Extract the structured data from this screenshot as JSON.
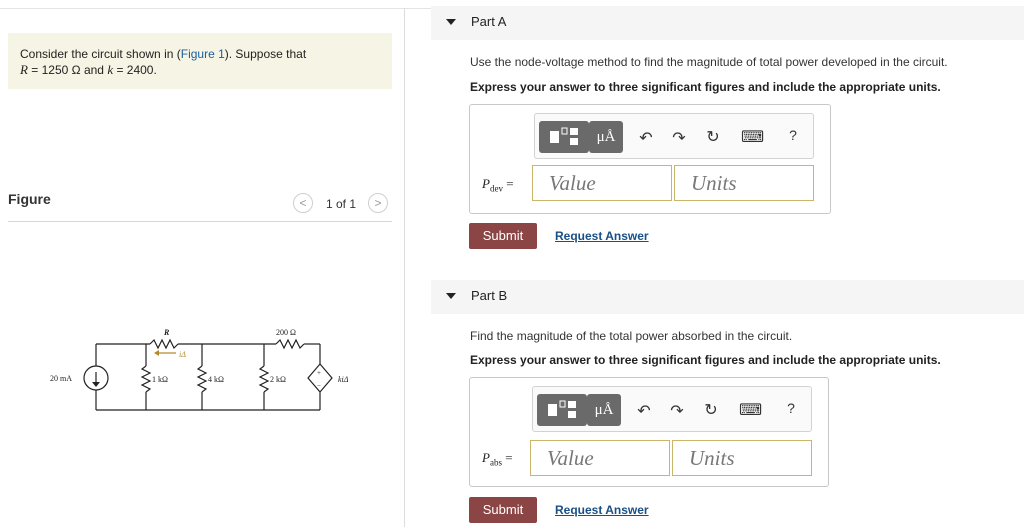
{
  "problem": {
    "prefix": "Consider the circuit shown in (",
    "figure_link": "Figure 1",
    "suffix": "). Suppose that",
    "line2_R": "R",
    "line2_rest": " = 1250  Ω and ",
    "line2_k": "k",
    "line2_end": " = 2400."
  },
  "figure": {
    "title": "Figure",
    "pager": "1 of 1",
    "prev_glyph": "<",
    "next_glyph": ">",
    "labels": {
      "R": "R",
      "ia": "iΔ",
      "r200": "200 Ω",
      "src": "20 mA",
      "r1k": "1 kΩ",
      "r4k": "4 kΩ",
      "r2k": "2 kΩ",
      "dep": "kiΔ",
      "plus": "+",
      "minus": "−"
    }
  },
  "partA": {
    "label": "Part A",
    "question": "Use the node-voltage method to find the magnitude of total power developed in the circuit.",
    "instruction": "Express your answer to three significant figures and include the appropriate units.",
    "var": "P",
    "var_sub": "dev",
    "eq": " =",
    "value_placeholder": "Value",
    "units_placeholder": "Units",
    "submit": "Submit",
    "request": "Request Answer"
  },
  "partB": {
    "label": "Part B",
    "question": "Find the magnitude of the total power absorbed in the circuit.",
    "instruction": "Express your answer to three significant figures and include the appropriate units.",
    "var": "P",
    "var_sub": "abs",
    "eq": " =",
    "value_placeholder": "Value",
    "units_placeholder": "Units",
    "submit": "Submit",
    "request": "Request Answer"
  },
  "toolbar": {
    "units_glyph": "μÅ",
    "undo_glyph": "↶",
    "redo_glyph": "↷",
    "reset_glyph": "↻",
    "keyboard_glyph": "⌨",
    "help_glyph": "?",
    "icons": [
      "templates-icon",
      "units-icon",
      "undo-icon",
      "redo-icon",
      "reset-icon",
      "keyboard-icon",
      "help-icon"
    ]
  },
  "colors": {
    "accent": "#8c4545",
    "link": "#1a4f86",
    "field_border": "#c9b66a",
    "problem_bg": "#f6f4e4"
  }
}
